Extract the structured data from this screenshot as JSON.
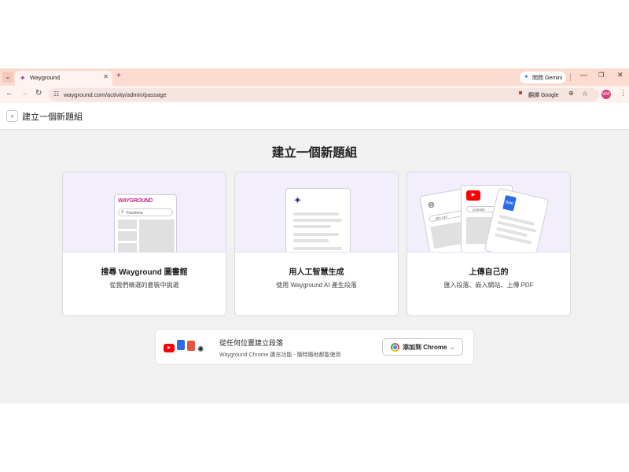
{
  "browser": {
    "tab": {
      "title": "Wayground"
    },
    "gemini_label": "問問 Gemini",
    "url": "wayground.com/activity/admin/passage",
    "google_lens_label": "翻譯 Google",
    "avatar_text": "WW"
  },
  "page": {
    "header_title": "建立一個新題組",
    "main_title": "建立一個新題組"
  },
  "cards": [
    {
      "title": "搜尋 Wayground 圖書館",
      "subtitle": "從我們精選的套裝中挑選",
      "art_logo": "WAYGROUND",
      "art_search": "Fractions"
    },
    {
      "title": "用人工智慧生成",
      "subtitle": "使用 Wayground AI 產生段落"
    },
    {
      "title": "上傳自己的",
      "subtitle": "匯入段落、嵌入網站、上傳 PDF",
      "art_url_1": "abc.xyz",
      "art_url_2": "youtube",
      "art_doc": "DOC"
    }
  ],
  "chrome_banner": {
    "title": "從任何位置建立段落",
    "subtitle": "Wayground Chrome 擴充功能 - 隨時隨地都能使用",
    "button_label": "添加到 Chrome →"
  },
  "colors": {
    "brand": "#c02c86",
    "card_art_bg": "#f3eefc",
    "tab_strip": "#fbdad0"
  }
}
